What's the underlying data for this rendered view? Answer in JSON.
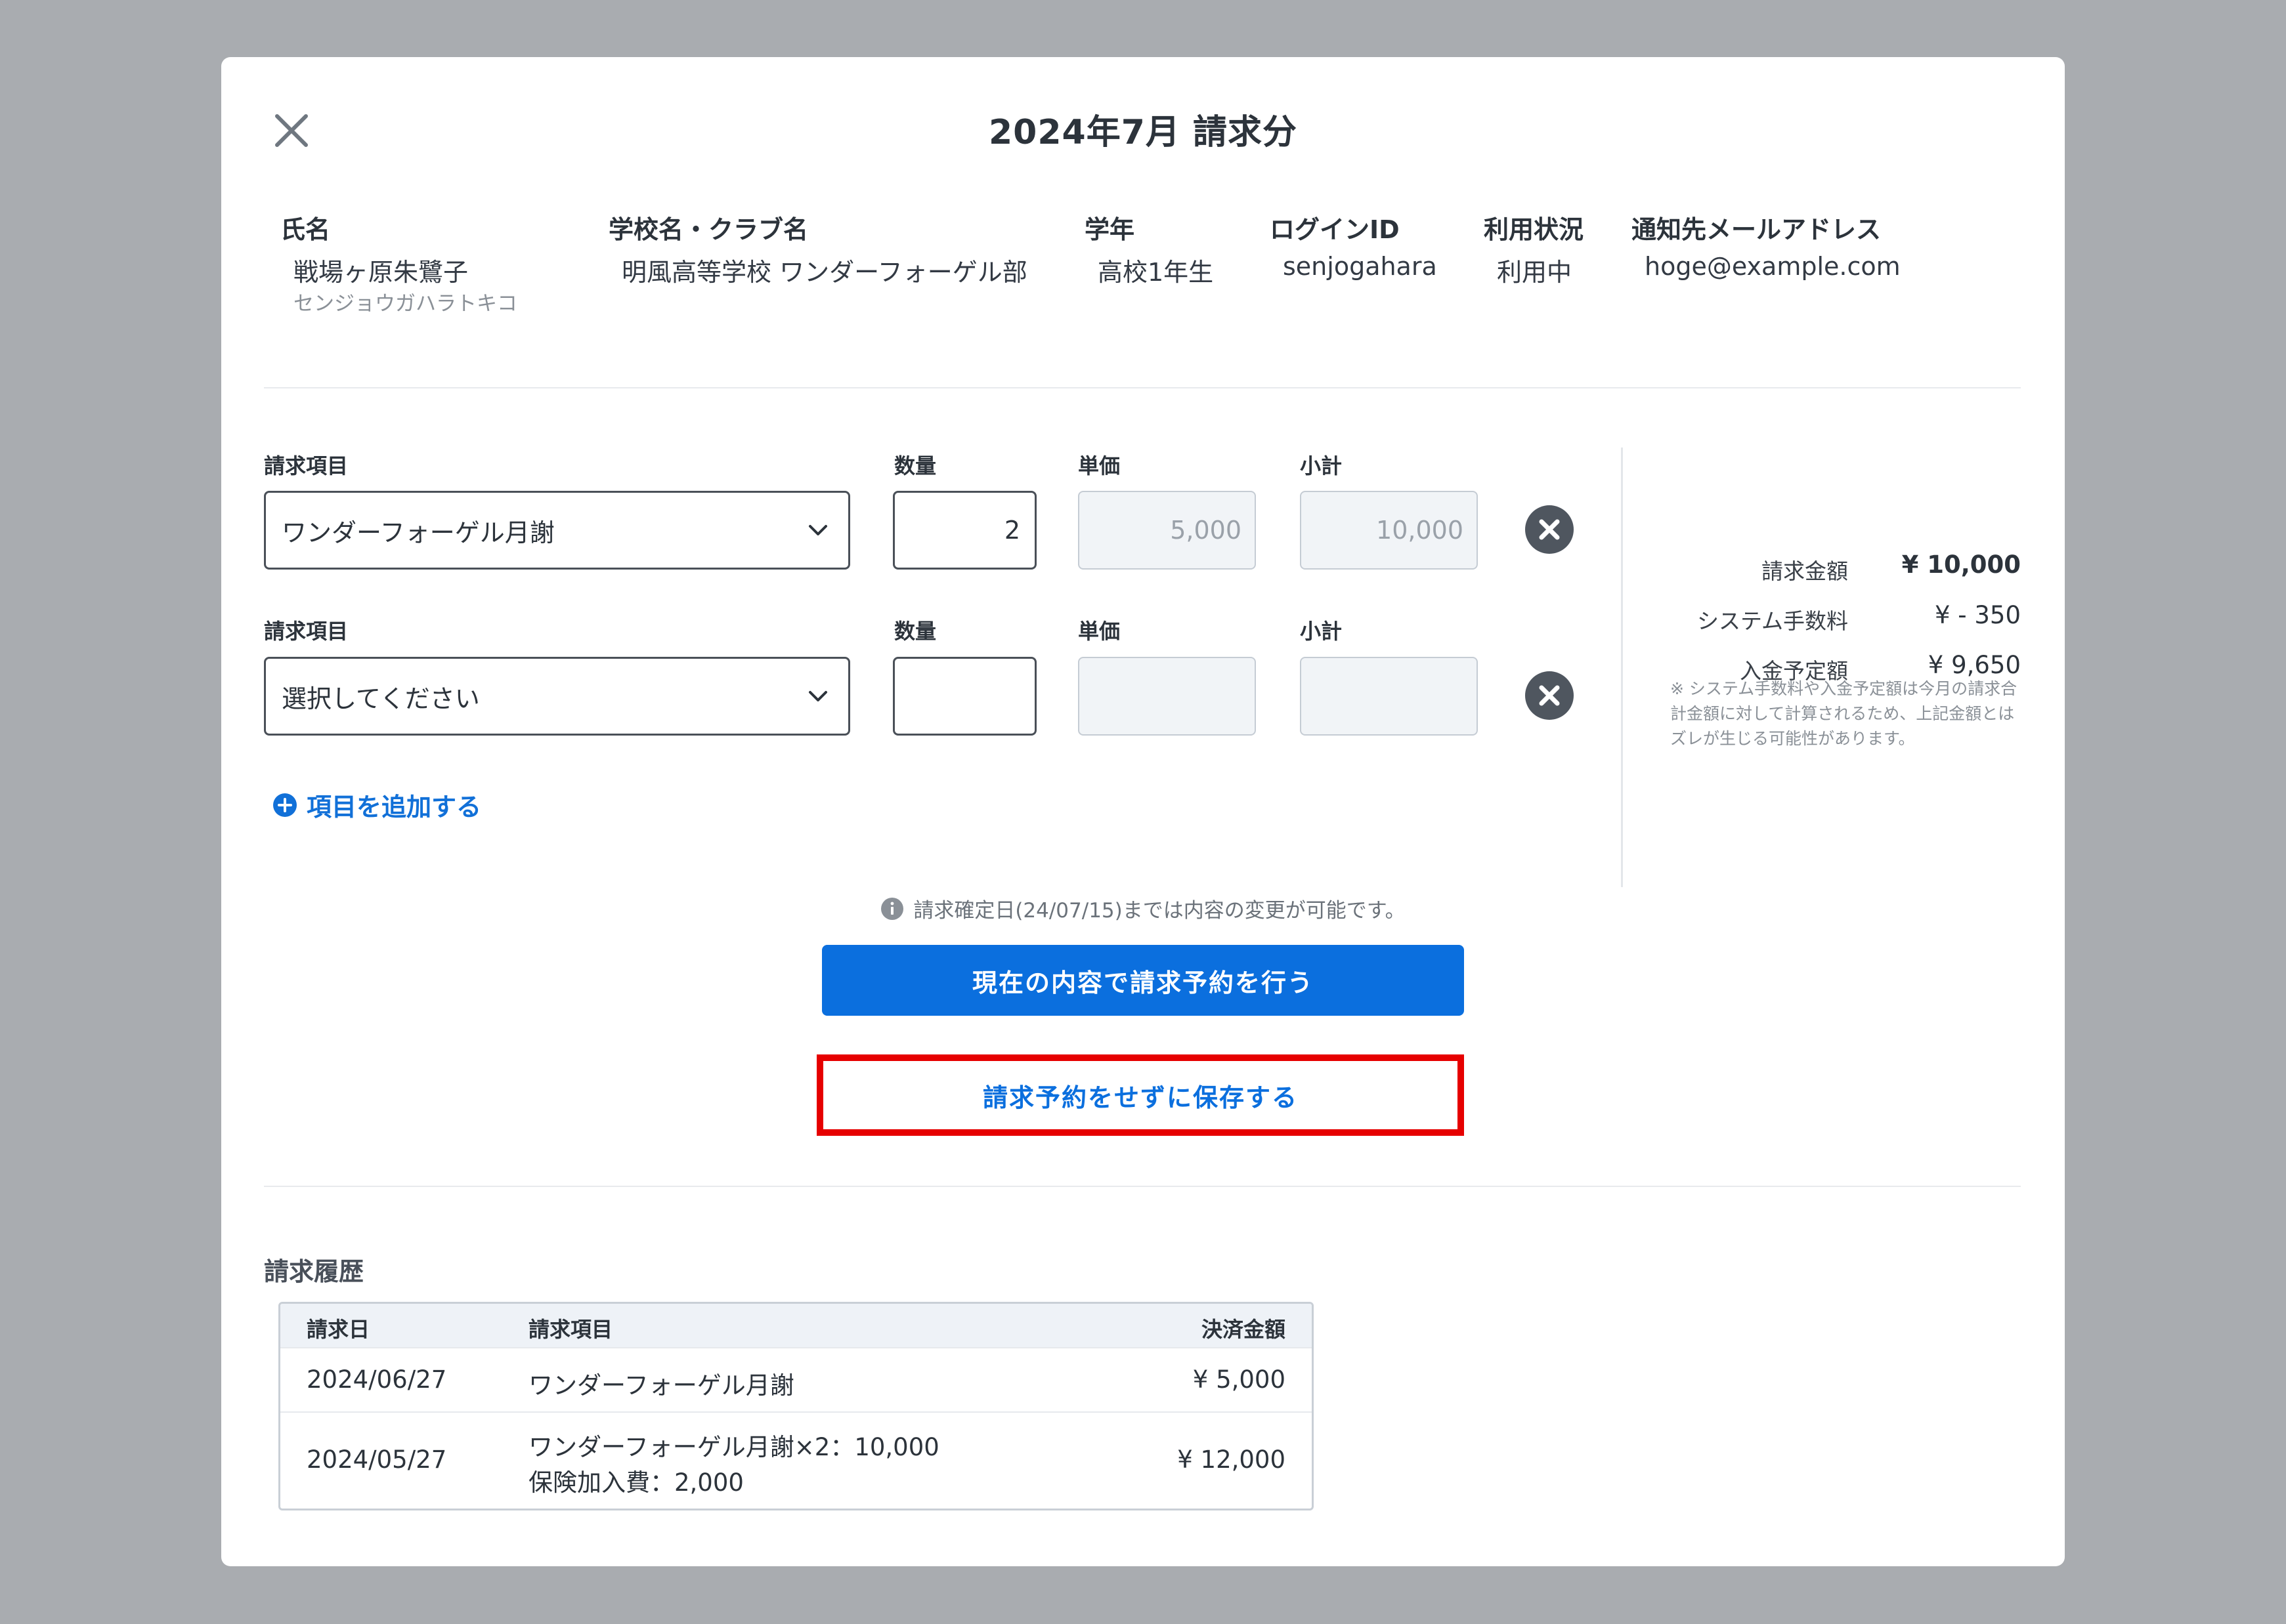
{
  "modal": {
    "title": "2024年7月 請求分"
  },
  "student": {
    "name_label": "氏名",
    "name": "戦場ヶ原朱鷺子",
    "name_kana": "センジョウガハラトキコ",
    "school_label": "学校名・クラブ名",
    "school": "明風高等学校 ワンダーフォーゲル部",
    "grade_label": "学年",
    "grade": "高校1年生",
    "login_label": "ログインID",
    "login": "senjogahara",
    "status_label": "利用状況",
    "status": "利用中",
    "email_label": "通知先メールアドレス",
    "email": "hoge@example.com"
  },
  "items": [
    {
      "item_label": "請求項目",
      "item_value": "ワンダーフォーゲル月謝",
      "qty_label": "数量",
      "qty_value": "2",
      "price_label": "単価",
      "price_value": "5,000",
      "subtotal_label": "小計",
      "subtotal_value": "10,000"
    },
    {
      "item_label": "請求項目",
      "item_value": "選択してください",
      "qty_label": "数量",
      "qty_value": "",
      "price_label": "単価",
      "price_value": "",
      "subtotal_label": "小計",
      "subtotal_value": ""
    }
  ],
  "add_item_label": "項目を追加する",
  "summary": {
    "billing_label": "請求金額",
    "billing_value": "¥ 10,000",
    "fee_label": "システム手数料",
    "fee_value": "¥ - 350",
    "deposit_label": "入金予定額",
    "deposit_value": "¥ 9,650",
    "note": "※ システム手数料や入金予定額は今月の請求合計金額に対して計算されるため、上記金額とはズレが生じる可能性があります。"
  },
  "notice": "請求確定日(24/07/15)までは内容の変更が可能です。",
  "buttons": {
    "reserve": "現在の内容で請求予約を行う",
    "save": "請求予約をせずに保存する"
  },
  "history": {
    "title": "請求履歴",
    "headers": [
      "請求日",
      "請求項目",
      "決済金額"
    ],
    "rows": [
      {
        "date": "2024/06/27",
        "item_line1": "ワンダーフォーゲル月謝",
        "item_line2": "",
        "amount": "¥ 5,000"
      },
      {
        "date": "2024/05/27",
        "item_line1": "ワンダーフォーゲル月謝×2：10,000",
        "item_line2": "保険加入費：2,000",
        "amount": "¥ 12,000"
      }
    ]
  },
  "colors": {
    "accent": "#0b6fde",
    "highlight": "#e60000",
    "backdrop": "#a9acb0"
  }
}
